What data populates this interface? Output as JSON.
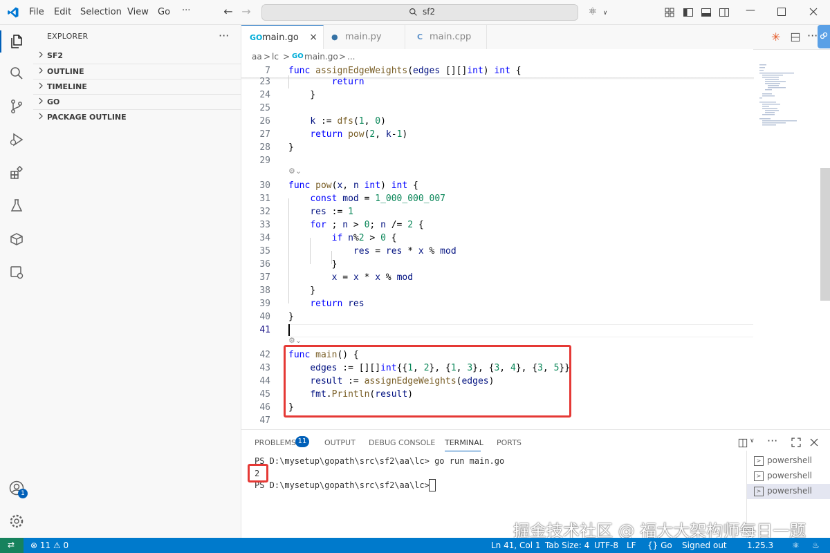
{
  "menu": [
    "File",
    "Edit",
    "Selection",
    "View",
    "Go",
    "···"
  ],
  "search": {
    "text": "sf2"
  },
  "explorer": {
    "title": "EXPLORER",
    "more": "···",
    "sections": [
      "SF2",
      "OUTLINE",
      "TIMELINE",
      "GO",
      "PACKAGE OUTLINE"
    ]
  },
  "tabs": [
    {
      "label": "main.go",
      "icon": "GO",
      "active": true
    },
    {
      "label": "main.py",
      "icon": "py",
      "active": false
    },
    {
      "label": "main.cpp",
      "icon": "C",
      "active": false
    }
  ],
  "breadcrumb": [
    "aa",
    ">",
    "lc",
    ">",
    "main.go",
    ">",
    "..."
  ],
  "editor": {
    "sticky": {
      "num": "7",
      "tokens": [
        [
          "k",
          "func "
        ],
        [
          "f",
          "assignEdgeWeights"
        ],
        [
          "p",
          "("
        ],
        [
          "v",
          "edges "
        ],
        [
          "p",
          "[][]"
        ],
        [
          "k",
          "int"
        ],
        [
          "p",
          ") "
        ],
        [
          "k",
          "int"
        ],
        [
          "p",
          " {"
        ]
      ]
    },
    "lines": [
      {
        "num": "23",
        "tokens": [
          [
            "p",
            "        "
          ],
          [
            "k",
            "return"
          ]
        ]
      },
      {
        "num": "24",
        "tokens": [
          [
            "p",
            "    }"
          ]
        ]
      },
      {
        "num": "25",
        "tokens": []
      },
      {
        "num": "26",
        "tokens": [
          [
            "p",
            "    "
          ],
          [
            "v",
            "k"
          ],
          [
            "p",
            " := "
          ],
          [
            "f",
            "dfs"
          ],
          [
            "p",
            "("
          ],
          [
            "n",
            "1"
          ],
          [
            "p",
            ", "
          ],
          [
            "n",
            "0"
          ],
          [
            "p",
            ")"
          ]
        ]
      },
      {
        "num": "27",
        "tokens": [
          [
            "p",
            "    "
          ],
          [
            "k",
            "return "
          ],
          [
            "f",
            "pow"
          ],
          [
            "p",
            "("
          ],
          [
            "n",
            "2"
          ],
          [
            "p",
            ", "
          ],
          [
            "v",
            "k"
          ],
          [
            "p",
            "-"
          ],
          [
            "n",
            "1"
          ],
          [
            "p",
            ")"
          ]
        ]
      },
      {
        "num": "28",
        "tokens": [
          [
            "p",
            "}"
          ]
        ]
      },
      {
        "num": "29",
        "tokens": []
      },
      {
        "num": "30",
        "tokens": [
          [
            "k",
            "func "
          ],
          [
            "f",
            "pow"
          ],
          [
            "p",
            "("
          ],
          [
            "v",
            "x"
          ],
          [
            "p",
            ", "
          ],
          [
            "v",
            "n "
          ],
          [
            "k",
            "int"
          ],
          [
            "p",
            ") "
          ],
          [
            "k",
            "int"
          ],
          [
            "p",
            " {"
          ]
        ]
      },
      {
        "num": "31",
        "tokens": [
          [
            "p",
            "    "
          ],
          [
            "k",
            "const "
          ],
          [
            "v",
            "mod"
          ],
          [
            "p",
            " = "
          ],
          [
            "n",
            "1_000_000_007"
          ]
        ]
      },
      {
        "num": "32",
        "tokens": [
          [
            "p",
            "    "
          ],
          [
            "v",
            "res"
          ],
          [
            "p",
            " := "
          ],
          [
            "n",
            "1"
          ]
        ]
      },
      {
        "num": "33",
        "tokens": [
          [
            "p",
            "    "
          ],
          [
            "k",
            "for"
          ],
          [
            "p",
            " ; "
          ],
          [
            "v",
            "n"
          ],
          [
            "p",
            " > "
          ],
          [
            "n",
            "0"
          ],
          [
            "p",
            "; "
          ],
          [
            "v",
            "n"
          ],
          [
            "p",
            " /= "
          ],
          [
            "n",
            "2"
          ],
          [
            "p",
            " {"
          ]
        ]
      },
      {
        "num": "34",
        "tokens": [
          [
            "p",
            "        "
          ],
          [
            "k",
            "if "
          ],
          [
            "v",
            "n"
          ],
          [
            "p",
            "%"
          ],
          [
            "n",
            "2"
          ],
          [
            "p",
            " > "
          ],
          [
            "n",
            "0"
          ],
          [
            "p",
            " {"
          ]
        ]
      },
      {
        "num": "35",
        "tokens": [
          [
            "p",
            "            "
          ],
          [
            "v",
            "res"
          ],
          [
            "p",
            " = "
          ],
          [
            "v",
            "res"
          ],
          [
            "p",
            " * "
          ],
          [
            "v",
            "x"
          ],
          [
            "p",
            " % "
          ],
          [
            "v",
            "mod"
          ]
        ]
      },
      {
        "num": "36",
        "tokens": [
          [
            "p",
            "        }"
          ]
        ]
      },
      {
        "num": "37",
        "tokens": [
          [
            "p",
            "        "
          ],
          [
            "v",
            "x"
          ],
          [
            "p",
            " = "
          ],
          [
            "v",
            "x"
          ],
          [
            "p",
            " * "
          ],
          [
            "v",
            "x"
          ],
          [
            "p",
            " % "
          ],
          [
            "v",
            "mod"
          ]
        ]
      },
      {
        "num": "38",
        "tokens": [
          [
            "p",
            "    }"
          ]
        ]
      },
      {
        "num": "39",
        "tokens": [
          [
            "p",
            "    "
          ],
          [
            "k",
            "return "
          ],
          [
            "v",
            "res"
          ]
        ]
      },
      {
        "num": "40",
        "tokens": [
          [
            "p",
            "}"
          ]
        ]
      },
      {
        "num": "41",
        "tokens": [],
        "active": true
      },
      {
        "num": "42",
        "tokens": [
          [
            "k",
            "func "
          ],
          [
            "f",
            "main"
          ],
          [
            "p",
            "() {"
          ]
        ]
      },
      {
        "num": "43",
        "tokens": [
          [
            "p",
            "    "
          ],
          [
            "v",
            "edges"
          ],
          [
            "p",
            " := "
          ],
          [
            "p",
            "[][]"
          ],
          [
            "k",
            "int"
          ],
          [
            "p",
            "{{"
          ],
          [
            "n",
            "1"
          ],
          [
            "p",
            ", "
          ],
          [
            "n",
            "2"
          ],
          [
            "p",
            "}, {"
          ],
          [
            "n",
            "1"
          ],
          [
            "p",
            ", "
          ],
          [
            "n",
            "3"
          ],
          [
            "p",
            "}, {"
          ],
          [
            "n",
            "3"
          ],
          [
            "p",
            ", "
          ],
          [
            "n",
            "4"
          ],
          [
            "p",
            "}, {"
          ],
          [
            "n",
            "3"
          ],
          [
            "p",
            ", "
          ],
          [
            "n",
            "5"
          ],
          [
            "p",
            "}}"
          ]
        ]
      },
      {
        "num": "44",
        "tokens": [
          [
            "p",
            "    "
          ],
          [
            "v",
            "result"
          ],
          [
            "p",
            " := "
          ],
          [
            "f",
            "assignEdgeWeights"
          ],
          [
            "p",
            "("
          ],
          [
            "v",
            "edges"
          ],
          [
            "p",
            ")"
          ]
        ]
      },
      {
        "num": "45",
        "tokens": [
          [
            "p",
            "    "
          ],
          [
            "v",
            "fmt"
          ],
          [
            "p",
            "."
          ],
          [
            "f",
            "Println"
          ],
          [
            "p",
            "("
          ],
          [
            "v",
            "result"
          ],
          [
            "p",
            ")"
          ]
        ]
      },
      {
        "num": "46",
        "tokens": [
          [
            "p",
            "}"
          ]
        ]
      },
      {
        "num": "47",
        "tokens": []
      }
    ]
  },
  "panel": {
    "tabs": [
      "PROBLEMS",
      "OUTPUT",
      "DEBUG CONSOLE",
      "TERMINAL",
      "PORTS"
    ],
    "problems_count": "11",
    "terminal": [
      "PS D:\\mysetup\\gopath\\src\\sf2\\aa\\lc> go run main.go",
      "2",
      "PS D:\\mysetup\\gopath\\src\\sf2\\aa\\lc> "
    ],
    "terminals": [
      "powershell",
      "powershell",
      "powershell"
    ]
  },
  "status": {
    "problems": "⊗ 11 ⚠ 0",
    "position": "Ln 41, Col 1",
    "tab_size": "Tab Size: 4",
    "encoding": "UTF-8",
    "eol": "LF",
    "language": "{} Go",
    "account": "Signed out",
    "version": "1.25.3"
  },
  "account_badge": "1",
  "watermark": "掘金技术社区 @ 福大大架构师每日一题",
  "colors": {
    "accent": "#005fb8",
    "status": "#007acc",
    "highlight": "#e53935"
  }
}
